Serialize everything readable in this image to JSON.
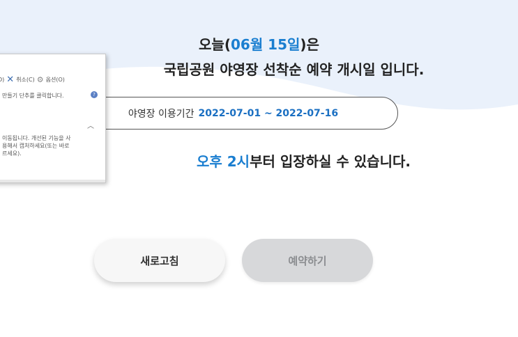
{
  "headline": {
    "prefix": "오늘(",
    "date": "06월 15일",
    "suffix": ")은",
    "line2": "국립공원 야영장 선착순 예약 개시일 입니다."
  },
  "period": {
    "label": "야영장 이용기간",
    "range": "2022-07-01 ~ 2022-07-16"
  },
  "entry": {
    "time": "오후 2시",
    "text": "부터 입장하실 수 있습니다."
  },
  "buttons": {
    "refresh": "새로고침",
    "reserve": "예약하기"
  },
  "snipping_tool": {
    "toolbar_prefix": "D)",
    "cancel": "취소(C)",
    "options": "옵션(O)",
    "hint": "만들기 단추를 클릭합니다.",
    "body_line1": "이동됩니다. 개선된 기능을 사",
    "body_line2": "용해서 캡처하세요(또는 바로",
    "body_line3": "르세요)."
  },
  "colors": {
    "accent": "#1a7ed0",
    "wave": "#e8f0fa",
    "disabled_button": "#d7d8da"
  }
}
